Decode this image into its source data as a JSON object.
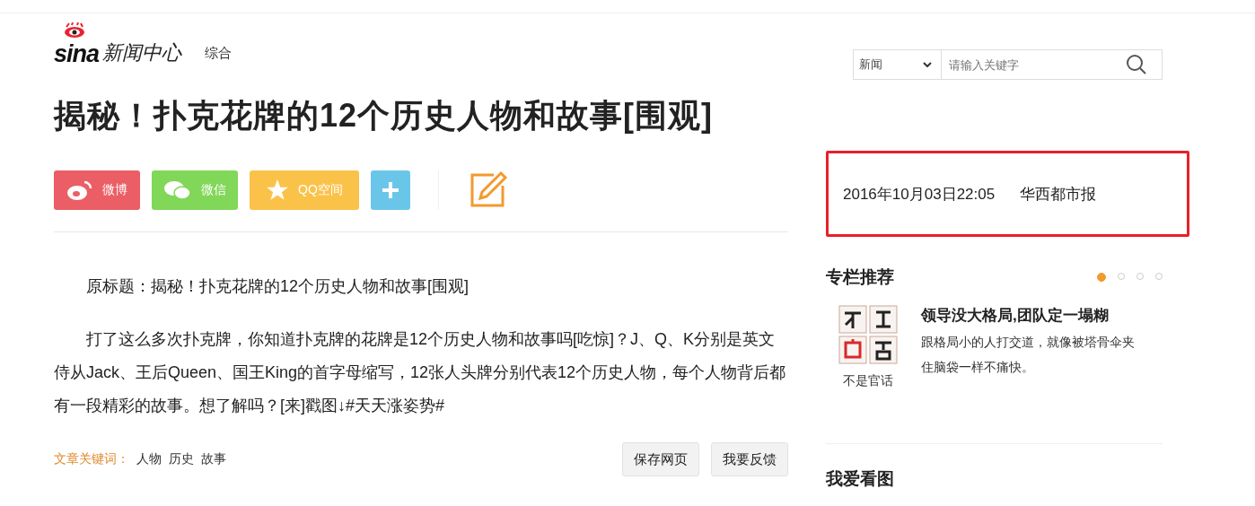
{
  "header": {
    "logo": {
      "brand": "sina",
      "name": "新闻中心"
    },
    "channel": "综合",
    "search": {
      "category": "新闻",
      "placeholder": "请输入关键字"
    }
  },
  "article": {
    "title": "揭秘！扑克花牌的12个历史人物和故事[围观]",
    "share": [
      {
        "kind": "weibo",
        "label": "微博"
      },
      {
        "kind": "wechat",
        "label": "微信"
      },
      {
        "kind": "qzone",
        "label": "QQ空间"
      },
      {
        "kind": "more"
      }
    ],
    "paragraphs": [
      "原标题：揭秘！扑克花牌的12个历史人物和故事[围观]",
      "打了这么多次扑克牌，你知道扑克牌的花牌是12个历史人物和故事吗[吃惊]？J、Q、K分别是英文侍从Jack、王后Queen、国王King的首字母缩写，12张人头牌分别代表12个历史人物，每个人物背后都有一段精彩的故事。想了解吗？[来]戳图↓#天天涨姿势#"
    ],
    "keywords_label": "文章关键词：",
    "keywords": [
      "人物",
      "历史",
      "故事"
    ],
    "buttons": [
      "保存网页",
      "我要反馈"
    ]
  },
  "meta": {
    "datetime": "2016年10月03日22:05",
    "source": "华西都市报",
    "highlighted": true
  },
  "sidebar": {
    "column_heading": "专栏推荐",
    "carousel_dots": [
      {
        "selected": true
      },
      {
        "selected": false
      },
      {
        "selected": false
      },
      {
        "selected": false
      }
    ],
    "feature": {
      "caption": "不是官话",
      "title": "领导没大格局,团队定一塌糊",
      "summary": "跟格局小的人打交道，就像被塔骨伞夹住脑袋一样不痛快。"
    },
    "next_heading": "我爱看图"
  }
}
